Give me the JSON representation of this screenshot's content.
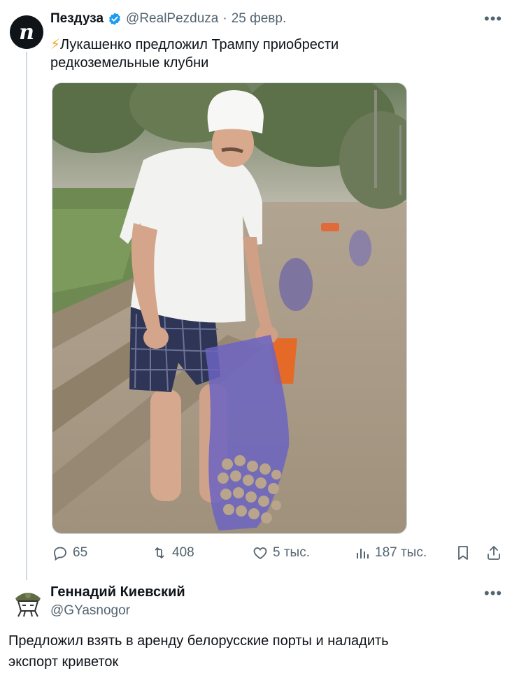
{
  "tweet1": {
    "display_name": "Пездуза",
    "handle": "@RealPezduza",
    "separator": "·",
    "date": "25 февр.",
    "more_icon": "more-horizontal-icon",
    "text_line1": "Лукашенко предложил Трампу приобрести",
    "text_line2": "редкоземельные клубни",
    "emoji": "⚡",
    "actions": {
      "replies": "65",
      "reposts": "408",
      "likes": "5 тыс.",
      "views": "187 тыс."
    },
    "avatar_letter": "п"
  },
  "tweet2": {
    "display_name": "Геннадий Киевский",
    "handle": "@GYasnogor",
    "text_line1": "Предложил взять в аренду белорусские порты и наладить",
    "text_line2": "экспорт криветок"
  },
  "colors": {
    "text": "#0f1419",
    "secondary": "#536471",
    "verified": "#1d9bf0",
    "divider": "#cfd9de"
  }
}
